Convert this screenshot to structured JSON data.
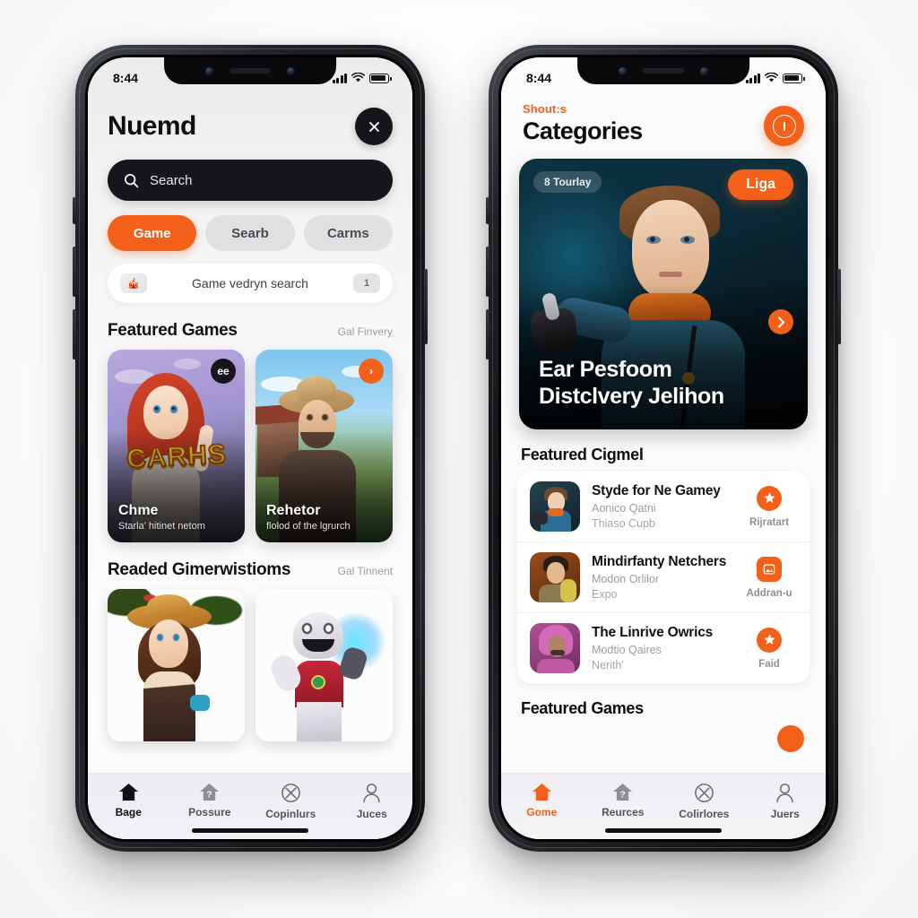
{
  "left_phone": {
    "status": {
      "time": "8:44",
      "signal_icon": "cellular-bars-icon",
      "wifi_icon": "wifi-icon",
      "battery_icon": "battery-icon"
    },
    "header": {
      "title": "Nuemd",
      "close_icon": "close-icon"
    },
    "search": {
      "placeholder": "Search",
      "icon": "search-icon"
    },
    "chips": [
      {
        "label": "Game",
        "active": true
      },
      {
        "label": "Searb",
        "active": false
      },
      {
        "label": "Carms",
        "active": false
      }
    ],
    "suggestion": {
      "thumb_icon": "game-thumb-icon",
      "text": "Game vedryn search",
      "badge": "1"
    },
    "featured": {
      "title": "Featured Games",
      "more": "Gal Finvery",
      "cards": [
        {
          "badge": "ee",
          "badge_style": "dark",
          "logo": "CARHS",
          "title": "Chme",
          "subtitle": "Starla' hitinet netom"
        },
        {
          "badge": "›",
          "badge_style": "orange",
          "logo": "",
          "title": "Rehetor",
          "subtitle": "flolod of the lgrurch"
        }
      ]
    },
    "recommended": {
      "title": "Readed Gimerwistioms",
      "more": "Gal Tinnent",
      "cards": [
        {
          "title": ""
        },
        {
          "title": ""
        }
      ]
    },
    "nav": [
      {
        "label": "Bage",
        "icon": "home-icon",
        "state": "active"
      },
      {
        "label": "Possure",
        "icon": "question-house-icon",
        "state": "idle"
      },
      {
        "label": "Copinlurs",
        "icon": "compass-x-icon",
        "state": "idle"
      },
      {
        "label": "Juces",
        "icon": "person-icon",
        "state": "idle"
      }
    ]
  },
  "right_phone": {
    "status": {
      "time": "8:44",
      "signal_icon": "cellular-bars-icon",
      "wifi_icon": "wifi-icon",
      "battery_icon": "battery-icon"
    },
    "header": {
      "eyebrow": "Shout:s",
      "title": "Categories",
      "fab_icon": "power-circle-icon"
    },
    "hero": {
      "tag": "8 Tourlay",
      "pill": "Liga",
      "next_icon": "chevron-right-icon",
      "line1": "Ear Pesfoom",
      "line2": "Distclvery Jelihon"
    },
    "featured_section": {
      "title": "Featured Cigmel"
    },
    "list": [
      {
        "name": "Styde for Ne Gamey",
        "sub1": "Aonico Qatni",
        "sub2": "Thiaso Cupb",
        "icon": "star-icon",
        "icon_shape": "circle",
        "action": "Rijratart",
        "thumb": "th-blue"
      },
      {
        "name": "Mindirfanty Netchers",
        "sub1": "Modon Orlilor",
        "sub2": "Expo",
        "icon": "image-icon",
        "icon_shape": "square",
        "action": "Addran-u",
        "thumb": "th-brown"
      },
      {
        "name": "The Linrive Owrics",
        "sub1": "Modtio Qaires",
        "sub2": "Nerith'",
        "icon": "star-icon",
        "icon_shape": "circle",
        "action": "Faid",
        "thumb": "th-pink"
      }
    ],
    "bottom_section": {
      "title": "Featured Games"
    },
    "nav": [
      {
        "label": "Gome",
        "icon": "home-icon",
        "state": "orange"
      },
      {
        "label": "Reurces",
        "icon": "question-house-icon",
        "state": "idle"
      },
      {
        "label": "Colirlores",
        "icon": "compass-x-icon",
        "state": "idle"
      },
      {
        "label": "Juers",
        "icon": "person-icon",
        "state": "idle"
      }
    ]
  },
  "theme": {
    "accent": "#F2601A",
    "dark": "#15161a",
    "bg": "#ffffff"
  }
}
